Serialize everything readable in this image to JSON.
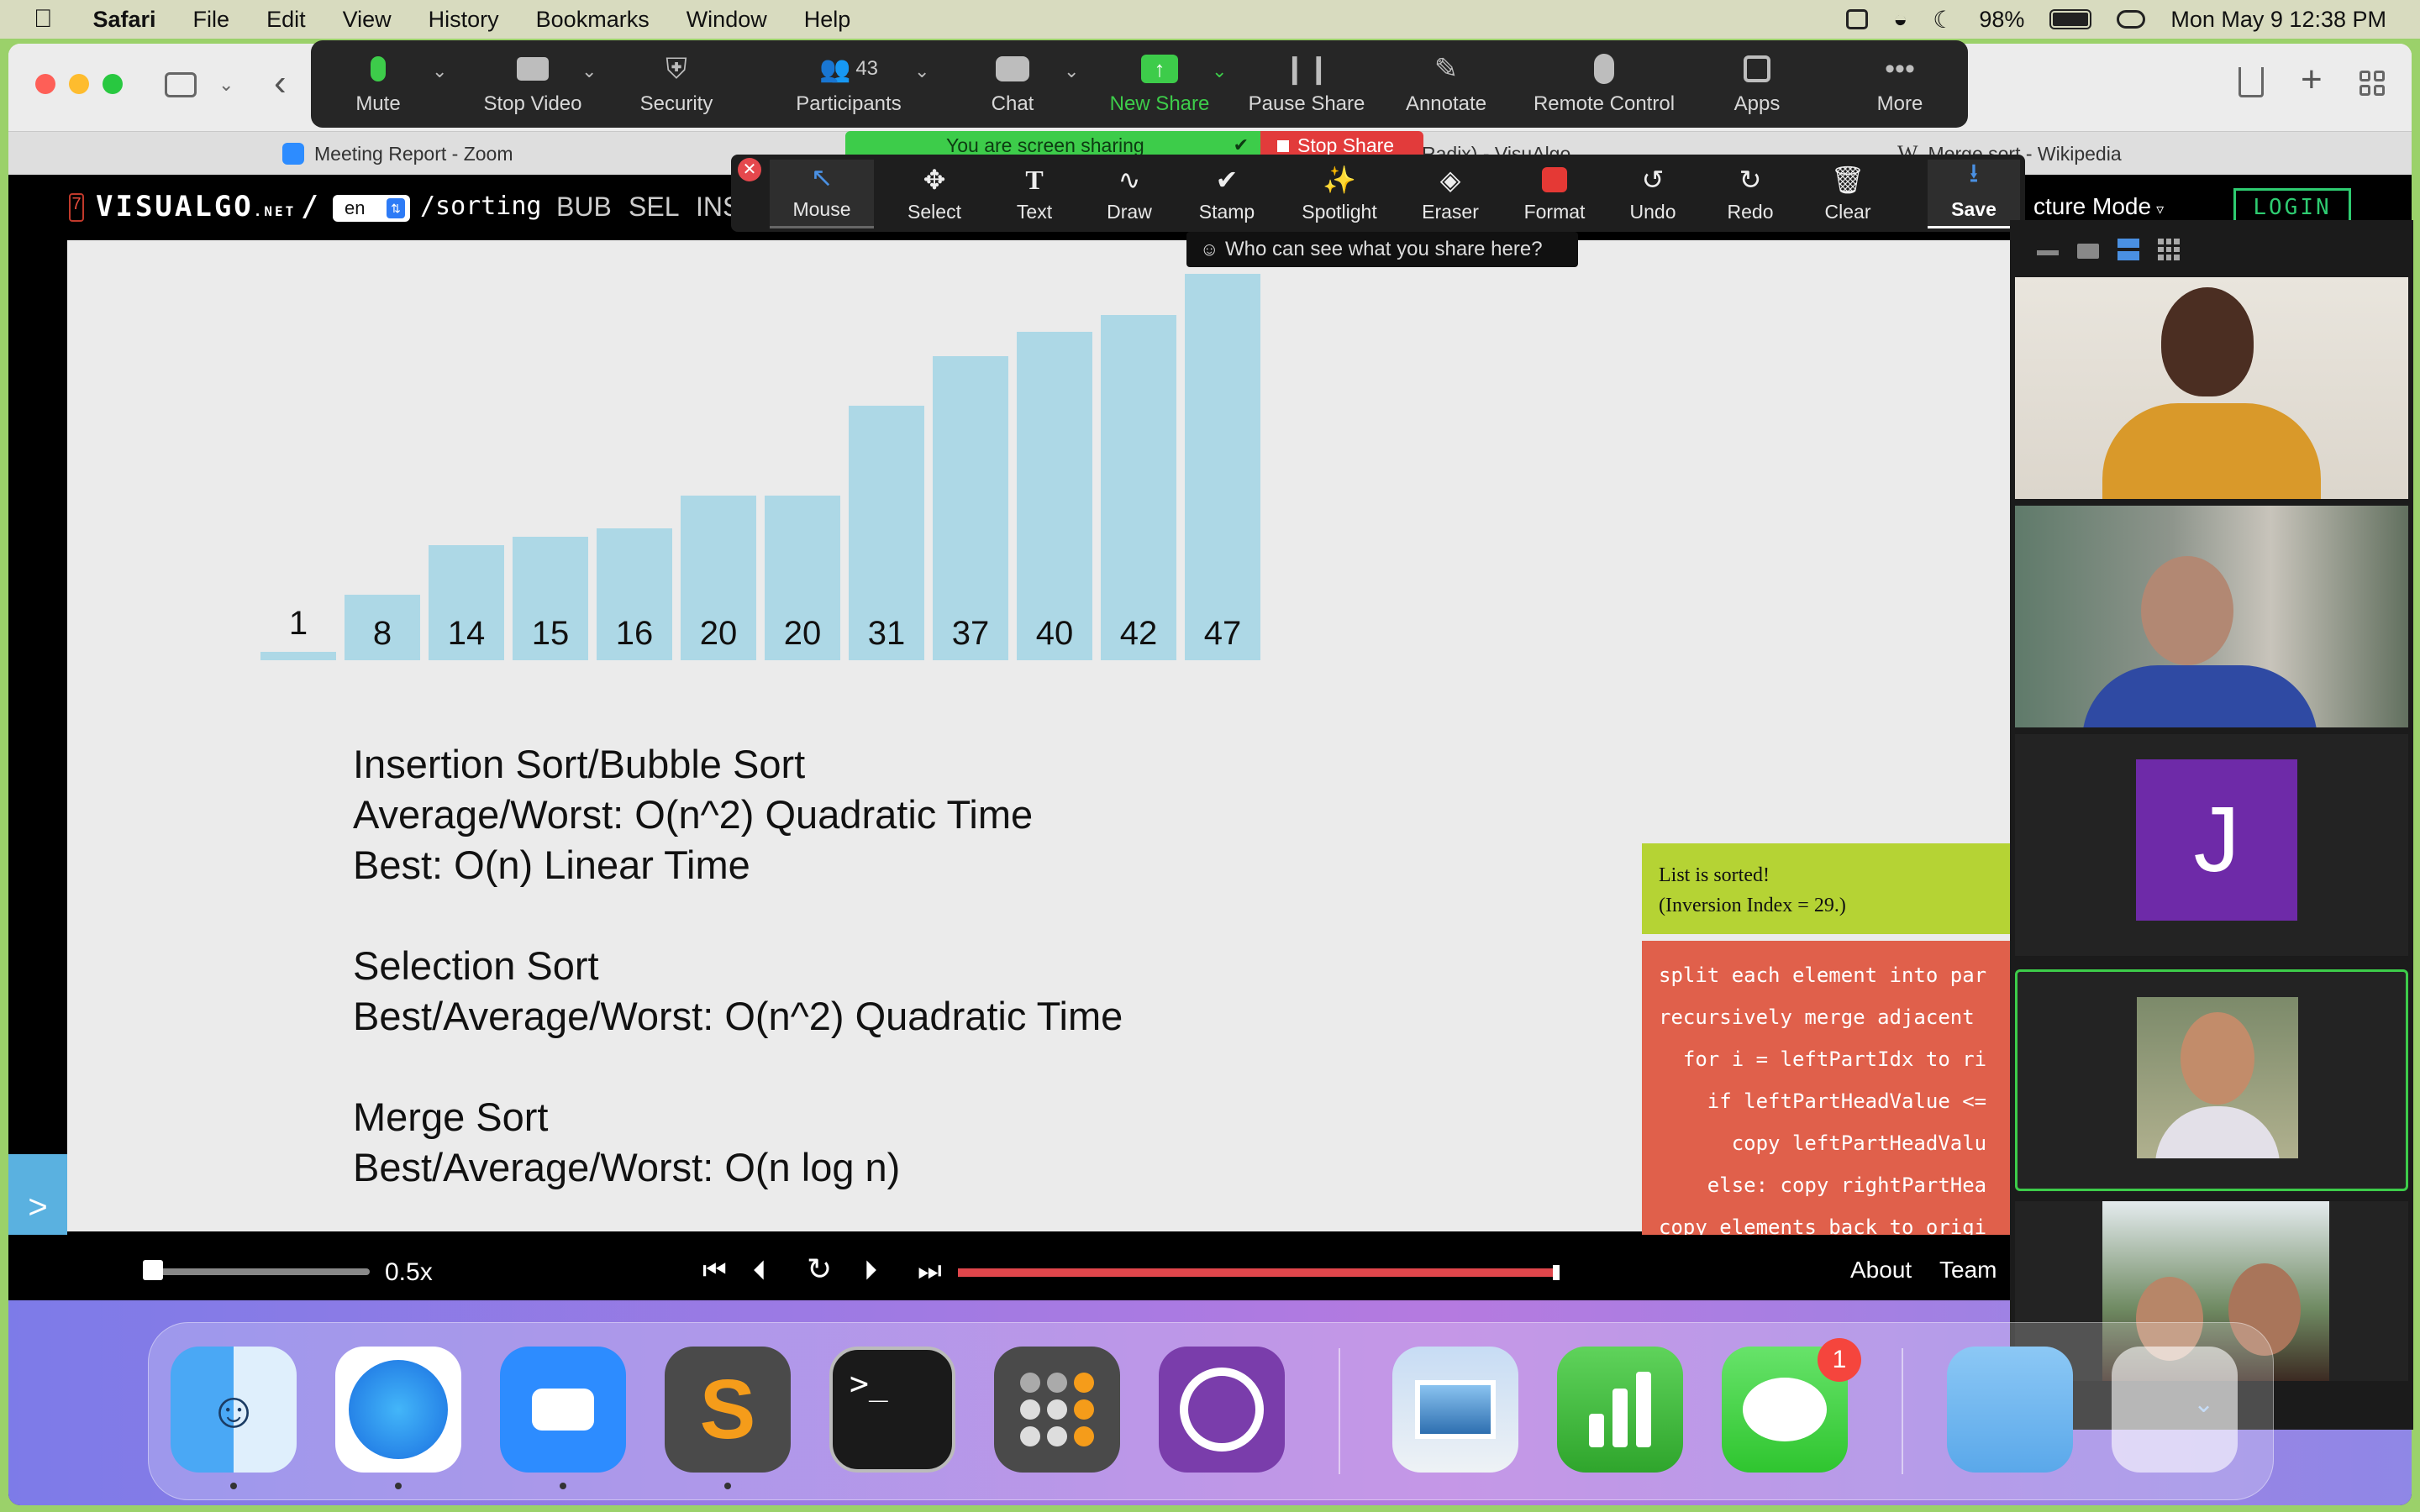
{
  "menubar": {
    "app": "Safari",
    "items": [
      "File",
      "Edit",
      "View",
      "History",
      "Bookmarks",
      "Window",
      "Help"
    ],
    "battery": "98%",
    "clock": "Mon May 9  12:38 PM"
  },
  "tabs": [
    {
      "label": "Meeting Report - Zoom"
    },
    {
      "label": "Radix) - VisuAlgo"
    },
    {
      "label": "Merge sort - Wikipedia"
    }
  ],
  "zoom_toolbar": {
    "buttons": [
      {
        "label": "Mute",
        "icon": "mic-icon"
      },
      {
        "label": "Stop Video",
        "icon": "video-camera-icon"
      },
      {
        "label": "Security",
        "icon": "shield-icon"
      },
      {
        "label": "Participants",
        "icon": "participants-icon",
        "count": "43"
      },
      {
        "label": "Chat",
        "icon": "chat-icon"
      },
      {
        "label": "New Share",
        "icon": "share-arrow-icon"
      },
      {
        "label": "Pause Share",
        "icon": "pause-icon"
      },
      {
        "label": "Annotate",
        "icon": "pencil-icon"
      },
      {
        "label": "Remote Control",
        "icon": "mouse-icon"
      },
      {
        "label": "Apps",
        "icon": "apps-icon"
      },
      {
        "label": "More",
        "icon": "more-icon"
      }
    ],
    "sharing_banner": "You are screen sharing",
    "stop_share": "Stop Share"
  },
  "annotate_toolbar": {
    "buttons": [
      "Mouse",
      "Select",
      "Text",
      "Draw",
      "Stamp",
      "Spotlight",
      "Eraser",
      "Format",
      "Undo",
      "Redo",
      "Clear",
      "Save"
    ],
    "tooltip": "Who can see what you share here?"
  },
  "visualgo": {
    "logo": "VISUALGO",
    "logo_net": ".NET",
    "slash": "/",
    "lang": "en",
    "path": "/sorting",
    "algos": [
      "BUB",
      "SEL",
      "INS"
    ],
    "mode": "cture Mode",
    "login": "LOGIN"
  },
  "chart_data": {
    "type": "bar",
    "categories": [
      "1",
      "8",
      "14",
      "15",
      "16",
      "20",
      "20",
      "31",
      "37",
      "40",
      "42",
      "47"
    ],
    "values": [
      1,
      8,
      14,
      15,
      16,
      20,
      20,
      31,
      37,
      40,
      42,
      47
    ]
  },
  "notes": [
    "Insertion Sort/Bubble Sort",
    "Average/Worst: O(n^2) Quadratic Time",
    "Best: O(n) Linear Time",
    "Selection Sort",
    "Best/Average/Worst: O(n^2) Quadratic Time",
    "Merge Sort",
    "Best/Average/Worst: O(n log n)"
  ],
  "status": {
    "line1": "List is sorted!",
    "line2": "(Inversion Index = 29.)"
  },
  "pseudocode": [
    "split each element into par",
    "recursively merge adjacent",
    "  for i = leftPartIdx to ri",
    "    if leftPartHeadValue <=",
    "      copy leftPartHeadValu",
    "    else: copy rightPartHea",
    "copy elements back to origi"
  ],
  "controls": {
    "speed": "0.5x",
    "progress": 1.0,
    "about": "About",
    "team": "Team"
  },
  "side_toggle": ">",
  "video_panel": {
    "tile3_initial": "J"
  },
  "dock": {
    "messages_badge": "1",
    "apps": [
      "finder-icon",
      "safari-icon",
      "zoom-icon",
      "sublime-icon",
      "terminal-icon",
      "calculator-icon",
      "github-icon",
      "preview-icon",
      "numbers-icon",
      "messages-icon",
      "folder-icon"
    ]
  },
  "colors": {
    "bar": "#add8e6",
    "status_green": "#b5d334",
    "pseudo_red": "#e0604b",
    "zoom_green": "#3dcc4a",
    "stop_red": "#e23b3b",
    "initial_tile": "#6e2aa8"
  }
}
